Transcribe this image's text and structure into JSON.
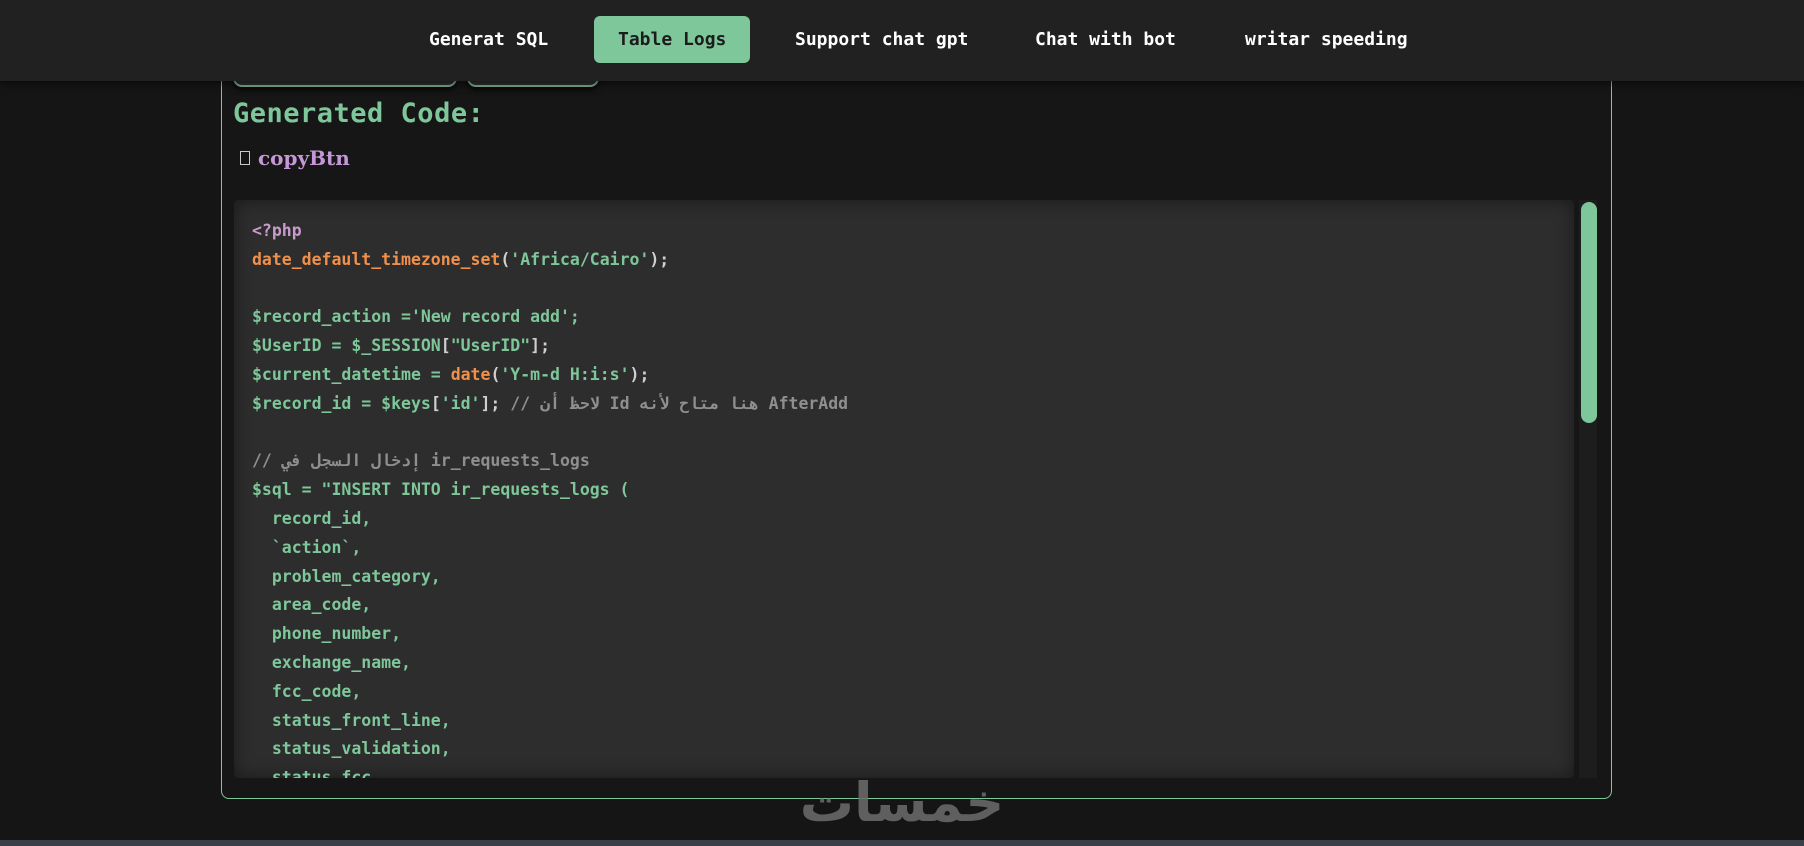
{
  "nav": {
    "items": [
      {
        "label": "Generat SQL",
        "active": false
      },
      {
        "label": "Table Logs",
        "active": true
      },
      {
        "label": "Support chat gpt",
        "active": false
      },
      {
        "label": "Chat with bot",
        "active": false
      },
      {
        "label": "writar speeding",
        "active": false
      }
    ]
  },
  "main": {
    "title": "Generated Code:",
    "copy_icon": "copy-icon",
    "copy_label": "copyBtn"
  },
  "code": {
    "l1_tag": "<?php",
    "l2_fn": "date_default_timezone_set",
    "l2_open": "(",
    "l2_str": "'Africa/Cairo'",
    "l2_close": ");",
    "l4_var": "$record_action =",
    "l4_str": "'New record add';",
    "l5_a": "$UserID = $_SESSION",
    "l5_b": "[",
    "l5_c": "\"UserID\"",
    "l5_d": "];",
    "l6_a": "$current_datetime = ",
    "l6_fn": "date",
    "l6_open": "(",
    "l6_str": "'Y-m-d H:i:s'",
    "l6_close": ");",
    "l7_a": "$record_id = $keys",
    "l7_b": "[",
    "l7_c": "'id'",
    "l7_d": "];",
    "l7_cmt": " // لاحظ أن Id هنا متاح لأنه AfterAdd",
    "l9_cmt": "// إدخال السجل في ir_requests_logs",
    "l10": "$sql = \"INSERT INTO ir_requests_logs (",
    "l11": "  record_id,",
    "l12": "  `action`,",
    "l13": "  problem_category,",
    "l14": "  area_code,",
    "l15": "  phone_number,",
    "l16": "  exchange_name,",
    "l17": "  fcc_code,",
    "l18": "  status_front_line,",
    "l19": "  status_validation,",
    "l20": "  status_fcc,"
  },
  "watermark": "خمسات",
  "colors": {
    "accent": "#7ec79a",
    "navbar": "#212121",
    "background": "#151515",
    "code_bg": "#2d2d2d",
    "function": "#f0904a",
    "tag": "#c99acc",
    "comment": "#8f8f8f"
  }
}
